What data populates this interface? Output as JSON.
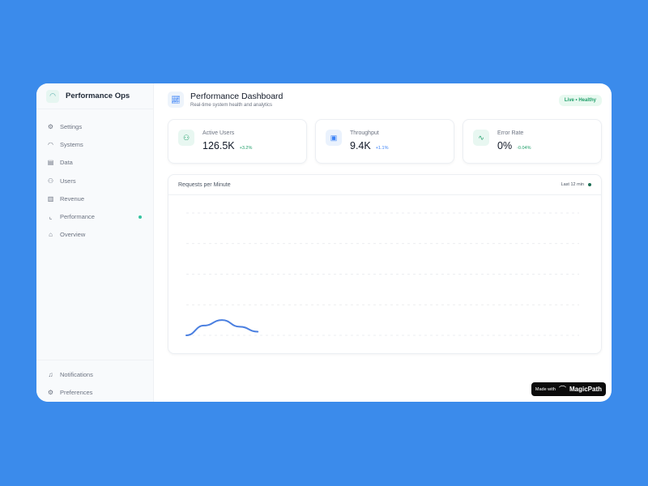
{
  "app": {
    "name": "Performance Ops"
  },
  "sidebar": {
    "items": [
      {
        "label": "Settings",
        "icon": "gear-icon",
        "glyph": "⚙"
      },
      {
        "label": "Systems",
        "icon": "gauge-icon",
        "glyph": "◠"
      },
      {
        "label": "Data",
        "icon": "database-icon",
        "glyph": "▤"
      },
      {
        "label": "Users",
        "icon": "users-icon",
        "glyph": "⚇"
      },
      {
        "label": "Revenue",
        "icon": "bar-chart-icon",
        "glyph": "▥"
      },
      {
        "label": "Performance",
        "icon": "line-chart-icon",
        "glyph": "⌞",
        "active": true
      },
      {
        "label": "Overview",
        "icon": "home-icon",
        "glyph": "⌂"
      }
    ],
    "bottom": [
      {
        "label": "Notifications",
        "glyph": "♫"
      },
      {
        "label": "Preferences",
        "glyph": "⚙"
      }
    ]
  },
  "header": {
    "title": "Performance Dashboard",
    "subtitle": "Real-time system health and analytics",
    "status": "Live • Healthy"
  },
  "metrics": [
    {
      "label": "Active Users",
      "value": "126.5K",
      "change": "+3.2%",
      "glyph": "⚇",
      "color": "#22a06b",
      "bg": "#e8f7f1"
    },
    {
      "label": "Throughput",
      "value": "9.4K",
      "change": "+1.1%",
      "glyph": "▣",
      "color": "#3b82f6",
      "bg": "#eaf2fd"
    },
    {
      "label": "Error Rate",
      "value": "0%",
      "change": "-0.04%",
      "glyph": "∿",
      "color": "#22a06b",
      "bg": "#e8f7f1"
    }
  ],
  "chart_data": {
    "type": "line",
    "title": "Requests per Minute",
    "range_label": "Last 12 min",
    "x": [
      0,
      0.5,
      1,
      1.5,
      2
    ],
    "values": [
      0,
      8,
      12.5,
      7,
      3
    ],
    "xlim": [
      0,
      11
    ],
    "ylim": [
      0,
      100
    ],
    "grid": true,
    "color": "#4a7fe0"
  },
  "footer": {
    "made_with": "Made with",
    "brand": "MagicPath"
  }
}
